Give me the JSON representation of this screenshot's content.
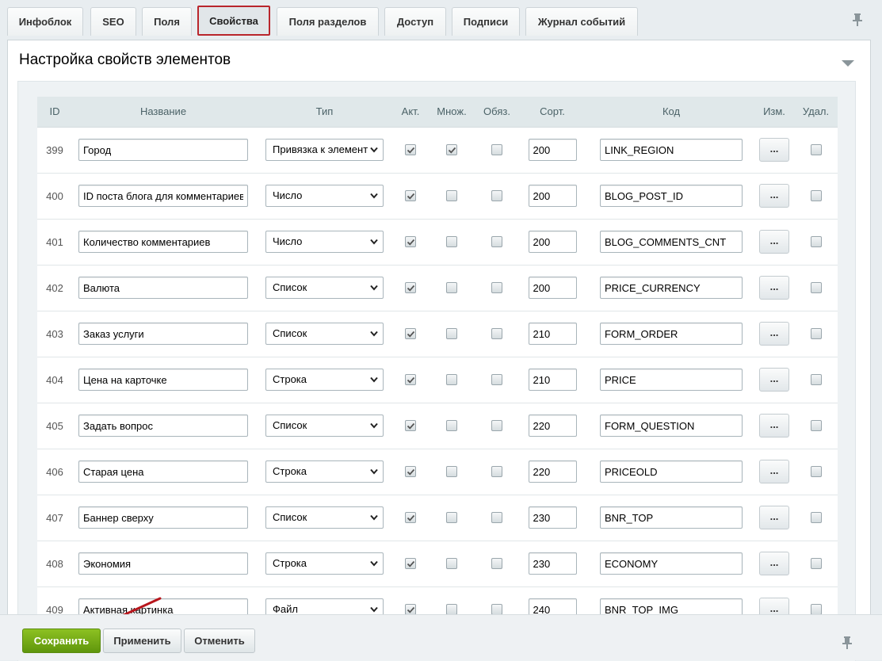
{
  "tabs": [
    {
      "label": "Инфоблок"
    },
    {
      "label": "SEO"
    },
    {
      "label": "Поля"
    },
    {
      "label": "Свойства"
    },
    {
      "label": "Поля разделов"
    },
    {
      "label": "Доступ"
    },
    {
      "label": "Подписи"
    },
    {
      "label": "Журнал событий"
    }
  ],
  "active_tab": "Свойства",
  "panel": {
    "title": "Настройка свойств элементов"
  },
  "table": {
    "headers": {
      "id": "ID",
      "name": "Название",
      "type": "Тип",
      "active": "Акт.",
      "multiple": "Множ.",
      "required": "Обяз.",
      "sort": "Сорт.",
      "code": "Код",
      "edit": "Изм.",
      "delete": "Удал."
    },
    "rows": [
      {
        "id": "399",
        "name": "Город",
        "type": "Привязка к элемент",
        "active": true,
        "multiple": true,
        "required": false,
        "sort": "200",
        "code": "LINK_REGION",
        "edit": "...",
        "delete": false
      },
      {
        "id": "400",
        "name": "ID поста блога для комментариев",
        "type": "Число",
        "active": true,
        "multiple": false,
        "required": false,
        "sort": "200",
        "code": "BLOG_POST_ID",
        "edit": "...",
        "delete": false
      },
      {
        "id": "401",
        "name": "Количество комментариев",
        "type": "Число",
        "active": true,
        "multiple": false,
        "required": false,
        "sort": "200",
        "code": "BLOG_COMMENTS_CNT",
        "edit": "...",
        "delete": false
      },
      {
        "id": "402",
        "name": "Валюта",
        "type": "Список",
        "active": true,
        "multiple": false,
        "required": false,
        "sort": "200",
        "code": "PRICE_CURRENCY",
        "edit": "...",
        "delete": false
      },
      {
        "id": "403",
        "name": "Заказ услуги",
        "type": "Список",
        "active": true,
        "multiple": false,
        "required": false,
        "sort": "210",
        "code": "FORM_ORDER",
        "edit": "...",
        "delete": false
      },
      {
        "id": "404",
        "name": "Цена на карточке",
        "type": "Строка",
        "active": true,
        "multiple": false,
        "required": false,
        "sort": "210",
        "code": "PRICE",
        "edit": "...",
        "delete": false
      },
      {
        "id": "405",
        "name": "Задать вопрос",
        "type": "Список",
        "active": true,
        "multiple": false,
        "required": false,
        "sort": "220",
        "code": "FORM_QUESTION",
        "edit": "...",
        "delete": false
      },
      {
        "id": "406",
        "name": "Старая цена",
        "type": "Строка",
        "active": true,
        "multiple": false,
        "required": false,
        "sort": "220",
        "code": "PRICEOLD",
        "edit": "...",
        "delete": false
      },
      {
        "id": "407",
        "name": "Баннер сверху",
        "type": "Список",
        "active": true,
        "multiple": false,
        "required": false,
        "sort": "230",
        "code": "BNR_TOP",
        "edit": "...",
        "delete": false
      },
      {
        "id": "408",
        "name": "Экономия",
        "type": "Строка",
        "active": true,
        "multiple": false,
        "required": false,
        "sort": "230",
        "code": "ECONOMY",
        "edit": "...",
        "delete": false
      },
      {
        "id": "409",
        "name": "Активная картинка",
        "type": "Файл",
        "active": true,
        "multiple": false,
        "required": false,
        "sort": "240",
        "code": "BNR_TOP_IMG",
        "edit": "...",
        "delete": false
      }
    ]
  },
  "footer": {
    "save_label": "Сохранить",
    "apply_label": "Применить",
    "cancel_label": "Отменить"
  },
  "colors": {
    "active_tab_border": "#b9262c",
    "save_button": "#6ea516",
    "annotation_arrow": "#b8161c"
  }
}
